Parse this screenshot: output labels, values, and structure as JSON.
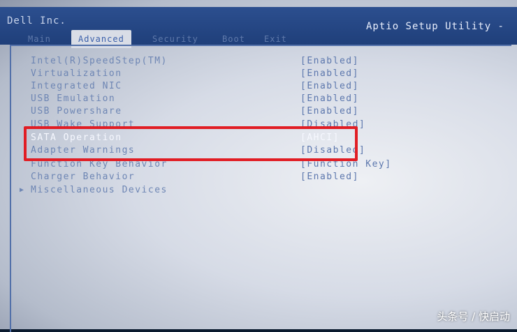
{
  "header": {
    "vendor": "Dell Inc.",
    "utility_title": "Aptio Setup Utility -",
    "tabs": [
      {
        "label": "Main"
      },
      {
        "label": "Advanced"
      },
      {
        "label": "Security"
      },
      {
        "label": "Boot"
      },
      {
        "label": "Exit"
      }
    ],
    "active_tab": "Advanced"
  },
  "settings": [
    {
      "label": "Intel(R)SpeedStep(TM)",
      "value": "[Enabled]"
    },
    {
      "label": "Virtualization",
      "value": "[Enabled]"
    },
    {
      "label": "Integrated NIC",
      "value": "[Enabled]"
    },
    {
      "label": "USB Emulation",
      "value": "[Enabled]"
    },
    {
      "label": "USB Powershare",
      "value": "[Enabled]"
    },
    {
      "label": "USB Wake Support",
      "value": "[Disabled]"
    },
    {
      "label": "SATA Operation",
      "value": "[AHCI]"
    },
    {
      "label": "Adapter Warnings",
      "value": "[Disabled]"
    },
    {
      "label": "Function Key Behavior",
      "value": "[Function Key]"
    },
    {
      "label": "Charger Behavior",
      "value": "[Enabled]"
    },
    {
      "label": "Miscellaneous Devices",
      "value": ""
    }
  ],
  "watermark": "头条号 / 快启动",
  "colors": {
    "header_bg": "#2c4f8f",
    "text": "#5c77ad",
    "highlight_box": "#e11d24"
  }
}
